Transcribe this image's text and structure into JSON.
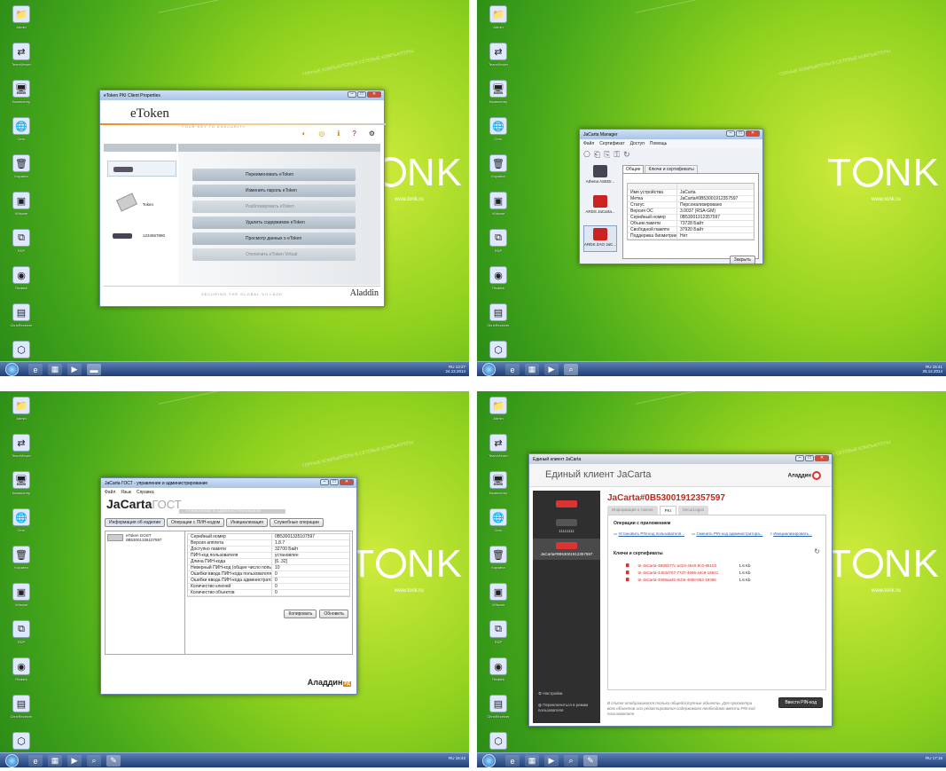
{
  "desktop": {
    "icons": [
      "Admin",
      "TeamViewer",
      "Компьютер",
      "Сеть",
      "Корзина",
      "VMware",
      "RDP",
      "Realtek",
      "CitrixReceiver",
      "Dropbox"
    ],
    "tonk": "T   NK",
    "url": "www.tonk.ru",
    "stripe": "ГОРНЫЕ КОМПЬЮТЕРЫ В СЕТЕВЫЕ КОМПЬЮТЕРЫ"
  },
  "etoken": {
    "title": "eToken PKI Client Properties",
    "logo": "eToken",
    "tagline": "YOUR KEY TO ESECURITY",
    "tokens": [
      "",
      "Token",
      "1234567890"
    ],
    "ops": [
      {
        "label": "Переименовать eToken",
        "enabled": true
      },
      {
        "label": "Изменить пароль eToken",
        "enabled": true
      },
      {
        "label": "Разблокировать eToken",
        "enabled": false
      },
      {
        "label": "Удалить содержимое eToken",
        "enabled": true
      },
      {
        "label": "Просмотр данных о eToken",
        "enabled": true
      },
      {
        "label": "Отключить eToken Virtual",
        "enabled": false
      }
    ],
    "footer": "SECURING THE GLOBAL VILLAGE",
    "brand": "Aladdin",
    "clock": "13:27",
    "date": "24.12.2014",
    "lang": "RU"
  },
  "jcmanager": {
    "title": "JaCarta Manager",
    "menu": [
      "Файл",
      "Сертификат",
      "Доступ",
      "Помощь"
    ],
    "readers": [
      "Athena ASEDr...",
      "ARDS JaCarta...",
      "ARDS ZAO JaC..."
    ],
    "tabs": [
      "Общие",
      "Ключи и сертификаты"
    ],
    "rows": [
      [
        "Имя устройства",
        "JaCarta"
      ],
      [
        "Метка",
        "JaCarta#0B53001912357597"
      ],
      [
        "Статус",
        "Персонализировано"
      ],
      [
        "Версия ОС",
        "3.0037 (RSA-GM)"
      ],
      [
        "Серийный номер",
        "0B53001912357597"
      ],
      [
        "Объем памяти",
        "73728 Байт"
      ],
      [
        "Свободной памяти",
        "37920 Байт"
      ],
      [
        "Поддержка биометрии",
        "Нет"
      ]
    ],
    "close": "Закрыть",
    "clock": "15:41",
    "date": "25.12.2014",
    "lang": "RU"
  },
  "gost": {
    "title": "JaCarta ГОСТ - управление и администрирование",
    "menu": [
      "Файл",
      "Язык",
      "Справка"
    ],
    "logo_main": "JaCarta",
    "logo_suffix": "ГОСТ",
    "subtitle": "УПРАВЛЕНИЕ И АДМИНИСТРИРОВАНИЕ",
    "tabs": [
      "Информация об изделии",
      "Операции с ПИН-кодом",
      "Инициализация",
      "Служебные операции"
    ],
    "device_name": "eToken GOST",
    "device_serial": "0B53001335107597",
    "rows": [
      [
        "Серийный номер",
        "0B53001335107597"
      ],
      [
        "Версия апплета",
        "1.8.7"
      ],
      [
        "Доступно памяти",
        "32700 Байт"
      ],
      [
        "ПИН-код пользователя",
        "установлен"
      ],
      [
        "Длина ПИН-кода",
        "[6..32]"
      ],
      [
        "Неверный ПИН-код (общее число попыток)",
        "10"
      ],
      [
        "Ошибки ввода ПИН-кода пользователя",
        "0"
      ],
      [
        "Ошибки ввода ПИН-кода администратора",
        "0"
      ],
      [
        "Количество ключей",
        "0"
      ],
      [
        "Количество объектов",
        "0"
      ]
    ],
    "copy": "Копировать",
    "refresh": "Обновить",
    "brand": "Аладдин",
    "brand_badge": "РД",
    "clock": "15:43",
    "lang": "RU"
  },
  "unified": {
    "title": "Единый клиент JaCarta",
    "header": "Единый клиент JaCarta",
    "brand": "Аладдин",
    "tokens": [
      "11111111",
      "JaCarta#0B53001912357597"
    ],
    "device": "JaCarta#0B53001912357597",
    "tabs": [
      "Информация о токене",
      "PKI",
      "SecurLogon"
    ],
    "ops_title": "Операции с приложением",
    "ops": [
      "Установить PIN-код пользователя...",
      "Сменить PIN-код администратора...",
      "Инициализировать..."
    ],
    "keys_title": "Ключи и сертификаты",
    "keys": [
      [
        "te-JaCarta-4B65b77c-a323-4640-8c0-96103",
        "1.6 Kb"
      ],
      [
        "te-JaCarta-4463d767-77d7-4696-a4c8-18641",
        "1.6 Kb"
      ],
      [
        "te-JaCarta-4598aa4b-8cb6-4658-863-19386",
        "1.6 Kb"
      ]
    ],
    "settings": "Настройки",
    "switch_mode": "Переключиться в режим пользователя",
    "note": "В списке отображаются только общедоступные объекты. Для просмотра всех объектов или редактирования содержимого необходимо ввести PIN-код пользователя",
    "pin_button": "Ввести PIN-код",
    "clock": "17:16",
    "lang": "RU"
  }
}
